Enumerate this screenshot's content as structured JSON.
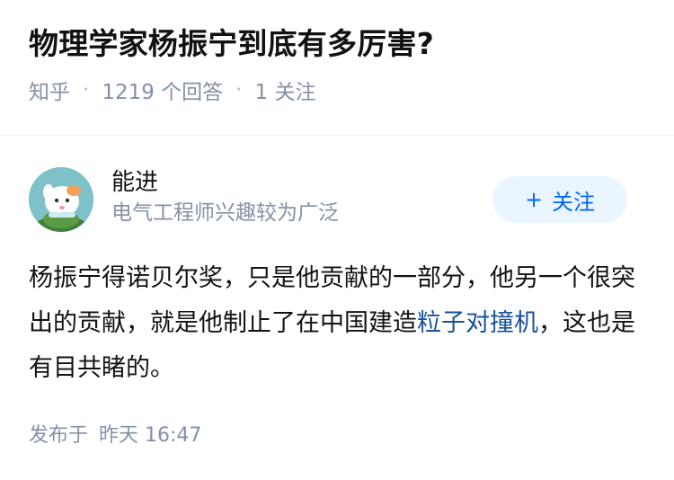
{
  "question": {
    "title": "物理学家杨振宁到底有多厉害?",
    "source": "知乎",
    "answers_count": "1219",
    "answers_suffix": "个回答",
    "followers_count": "1",
    "followers_suffix": "关注",
    "separator": "·"
  },
  "author": {
    "name": "能进",
    "bio": "电气工程师兴趣较为广泛",
    "follow_button": "关注",
    "follow_icon": "plus-icon"
  },
  "answer": {
    "text_part1": "杨振宁得诺贝尔奖，只是他贡献的一部分，他另一个很突出的贡献，就是他制止了在中国建造",
    "link_text": "粒子对撞机",
    "text_part2": "，这也是有目共睹的。"
  },
  "footer": {
    "published_label": "发布于",
    "published_time": "昨天 16:47"
  },
  "colors": {
    "accent": "#0066ff",
    "link": "#175199",
    "meta_gray": "#8590a6",
    "follow_bg": "#ebf5ff"
  }
}
